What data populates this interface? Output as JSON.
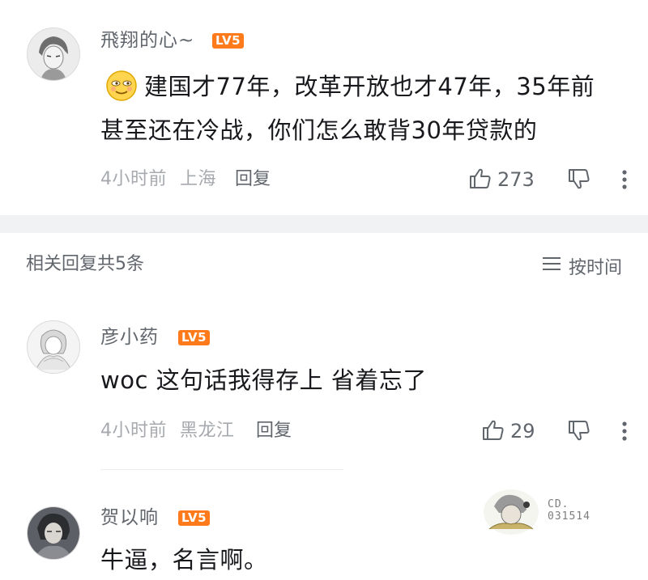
{
  "comments": [
    {
      "username": "飛翔的心~",
      "level": "LV5",
      "emoji": "smirk-emoji",
      "text_line1": "建国才77年，改革开放也才47年，35年前",
      "text_line2": "甚至还在冷战，你们怎么敢背30年贷款的",
      "time": "4小时前",
      "location": "上海",
      "reply_label": "回复",
      "likes": "273"
    },
    {
      "username": "彦小药",
      "level": "LV5",
      "text": "woc 这句话我得存上 省着忘了",
      "time": "4小时前",
      "location": "黑龙江",
      "reply_label": "回复",
      "likes": "29"
    },
    {
      "username": "贺以响",
      "level": "LV5",
      "text": "牛逼，名言啊。"
    }
  ],
  "replies_header": {
    "label": "相关回复共5条",
    "sort_label": "按时间"
  },
  "watermark": {
    "code_line1": "CD.",
    "code_line2": "031514"
  },
  "colors": {
    "level_badge": "#ff7a1a",
    "meta_gray": "#a6a9ad",
    "section_bg": "#f1f2f3"
  }
}
